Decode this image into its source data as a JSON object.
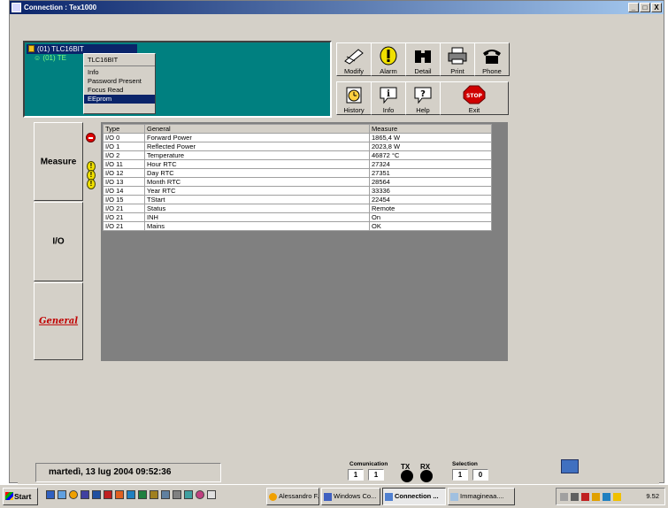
{
  "window": {
    "title": "Connection : Tex1000",
    "controls": [
      "_",
      "□",
      "X"
    ]
  },
  "device_panel": {
    "selected": "(01) TLC16BIT",
    "sub": "(01) TE",
    "menu": {
      "header": "TLC16BIT",
      "items": [
        "Info",
        "Password Present",
        "Focus Read",
        "EEprom"
      ],
      "selected": "EEprom"
    }
  },
  "toolbar": {
    "row1": [
      {
        "label": "Modify",
        "icon": "modify-icon"
      },
      {
        "label": "Alarm",
        "icon": "alarm-icon"
      },
      {
        "label": "Detail",
        "icon": "binoculars-icon"
      },
      {
        "label": "Print",
        "icon": "printer-icon"
      },
      {
        "label": "Phone",
        "icon": "phone-icon"
      }
    ],
    "row2": [
      {
        "label": "History",
        "icon": "history-icon"
      },
      {
        "label": "Info",
        "icon": "info-icon"
      },
      {
        "label": "Help",
        "icon": "help-icon"
      },
      {
        "label": "Exit",
        "icon": "stop-icon",
        "badge": "STOP"
      }
    ]
  },
  "side_tabs": [
    "Measure",
    "I/O",
    "General"
  ],
  "active_tab": "General",
  "table": {
    "headers": [
      "Type",
      "General",
      "Measure"
    ],
    "rows": [
      [
        "I/O 0",
        "Forward Power",
        "1865,4 W"
      ],
      [
        "I/O 1",
        "Reflected Power",
        "2023,8 W"
      ],
      [
        "I/O 2",
        "Temperature",
        "46872 °C"
      ],
      [
        "I/O 11",
        "Hour RTC",
        "27324"
      ],
      [
        "I/O 12",
        "Day RTC",
        "27351"
      ],
      [
        "I/O 13",
        "Month RTC",
        "28564"
      ],
      [
        "I/O 14",
        "Year RTC",
        "33336"
      ],
      [
        "I/O 15",
        "TStart",
        "22454"
      ],
      [
        "I/O 21",
        "Status",
        "Remote"
      ],
      [
        "I/O 21",
        "INH",
        "On"
      ],
      [
        "I/O 21",
        "Mains",
        "OK"
      ]
    ]
  },
  "status": {
    "datetime": "martedì, 13 lug 2004  09:52:36",
    "communication_label": "Comunication",
    "communication": [
      "1",
      "1"
    ],
    "tx_label": "TX",
    "rx_label": "RX",
    "selection_label": "Selection",
    "selection": [
      "1",
      "0"
    ]
  },
  "taskbar": {
    "start": "Start",
    "tasks": [
      {
        "label": "Alessandro F...",
        "active": false
      },
      {
        "label": "Windows Co...",
        "active": false
      },
      {
        "label": "Connection ...",
        "active": true
      },
      {
        "label": "Immagineaa....",
        "active": false
      }
    ],
    "clock": "9.52"
  }
}
